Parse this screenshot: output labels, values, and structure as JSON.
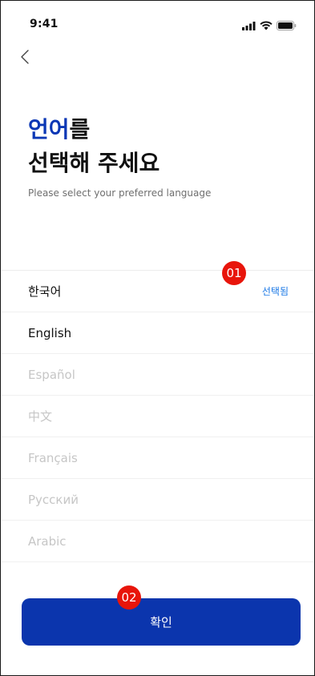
{
  "status": {
    "time": "9:41",
    "icons": [
      "signal-icon",
      "wifi-icon",
      "battery-icon"
    ]
  },
  "nav": {
    "back_icon": "chevron-left-icon"
  },
  "header": {
    "title_highlight": "언어",
    "title_rest": "를",
    "title_line2": "선택해 주세요",
    "subtitle": "Please select your preferred language"
  },
  "languages": [
    {
      "label": "한국어",
      "selected": true,
      "enabled": true
    },
    {
      "label": "English",
      "selected": false,
      "enabled": true
    },
    {
      "label": "Español",
      "selected": false,
      "enabled": false
    },
    {
      "label": "中文",
      "selected": false,
      "enabled": false
    },
    {
      "label": "Français",
      "selected": false,
      "enabled": false
    },
    {
      "label": "Русский",
      "selected": false,
      "enabled": false
    },
    {
      "label": "Arabic",
      "selected": false,
      "enabled": false
    }
  ],
  "selected_label": "선택됨",
  "badges": {
    "first": "01",
    "second": "02"
  },
  "confirm_label": "확인",
  "colors": {
    "accent": "#0b37b5",
    "button": "#0b35ad",
    "selected_text": "#1a78e6",
    "badge": "#e8150b",
    "disabled_text": "#c6c6c6"
  }
}
